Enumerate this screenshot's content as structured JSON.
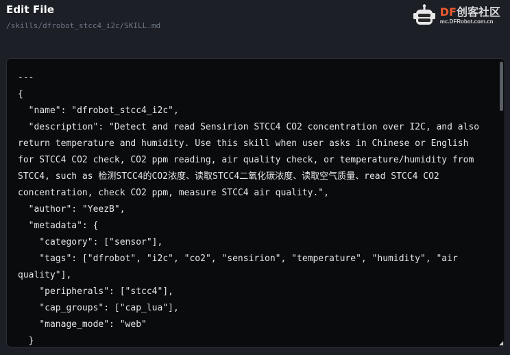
{
  "header": {
    "title": "Edit File",
    "path": "/skills/dfrobot_stcc4_i2c/SKILL.md"
  },
  "brand": {
    "name_prefix": "DF",
    "name_suffix": "创客社区",
    "url": "mc.DFRobot.com.cn",
    "accent": "#e85a2e"
  },
  "editor": {
    "content": "---\n{\n  \"name\": \"dfrobot_stcc4_i2c\",\n  \"description\": \"Detect and read Sensirion STCC4 CO2 concentration over I2C, and also return temperature and humidity. Use this skill when user asks in Chinese or English for STCC4 CO2 check, CO2 ppm reading, air quality check, or temperature/humidity from STCC4, such as 检测STCC4的CO2浓度、读取STCC4二氧化碳浓度、读取空气质量、read STCC4 CO2 concentration, check CO2 ppm, measure STCC4 air quality.\",\n  \"author\": \"YeezB\",\n  \"metadata\": {\n    \"category\": [\"sensor\"],\n    \"tags\": [\"dfrobot\", \"i2c\", \"co2\", \"sensirion\", \"temperature\", \"humidity\", \"air quality\"],\n    \"peripherals\": [\"stcc4\"],\n    \"cap_groups\": [\"cap_lua\"],\n    \"manage_mode\": \"web\"\n  }"
  }
}
